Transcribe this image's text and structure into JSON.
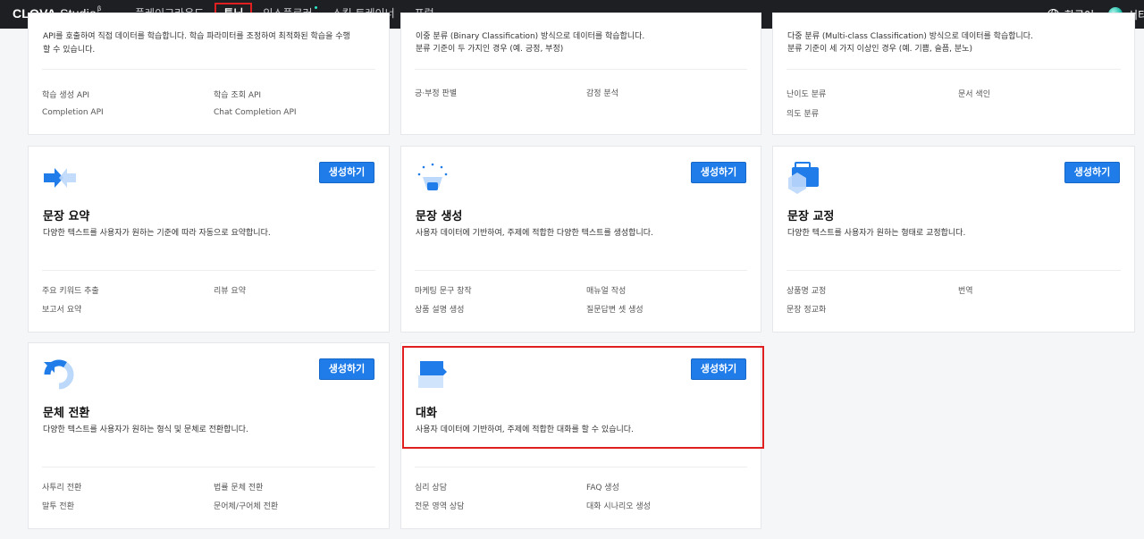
{
  "header": {
    "logo_brand": "CLOVA",
    "logo_product": "Studio",
    "logo_sup": "β",
    "nav": [
      {
        "label": "플레이그라운드"
      },
      {
        "label": "튜닝"
      },
      {
        "label": "익스플로러"
      },
      {
        "label": "스킬 트레이너"
      },
      {
        "label": "포럼"
      }
    ],
    "lang": "한국어",
    "user": "서티"
  },
  "top_cards": [
    {
      "desc_lines": [
        "API를 호출하여 직접 데이터를 학습합니다. 학습 파라미터를 조정하여 최적화된 학습을 수행",
        "할 수 있습니다."
      ],
      "tags": [
        "학습 생성 API",
        "학습 조회 API",
        "Completion API",
        "Chat Completion API"
      ]
    },
    {
      "desc_lines": [
        "이중 분류 (Binary Classification) 방식으로 데이터를 학습합니다.",
        "분류 기준이 두 가지인 경우 (예. 긍정, 부정)"
      ],
      "tags": [
        "긍·부정 판별",
        "감정 분석"
      ]
    },
    {
      "desc_lines": [
        "다중 분류 (Multi-class Classification) 방식으로 데이터를 학습합니다.",
        "분류 기준이 세 가지 이상인 경우 (예. 기쁨, 슬픔, 분노)"
      ],
      "tags": [
        "난이도 분류",
        "문서 색인",
        "의도 분류"
      ]
    }
  ],
  "cards": [
    {
      "title": "문장 요약",
      "desc": "다양한 텍스트를 사용자가 원하는 기준에 따라 자동으로 요약합니다.",
      "button": "생성하기",
      "icon": "arrows-summary-icon",
      "tags": [
        "주요 키워드 추출",
        "리뷰 요약",
        "보고서 요약"
      ]
    },
    {
      "title": "문장 생성",
      "desc": "사용자 데이터에 기반하여, 주제에 적합한 다양한 텍스트를 생성합니다.",
      "button": "생성하기",
      "icon": "lightbulb-icon",
      "tags": [
        "마케팅 문구 창작",
        "매뉴얼 작성",
        "상품 설명 생성",
        "질문답변 셋 생성"
      ]
    },
    {
      "title": "문장 교정",
      "desc": "다양한 텍스트를 사용자가 원하는 형태로 교정합니다.",
      "button": "생성하기",
      "icon": "toolbox-icon",
      "tags": [
        "상품명 교정",
        "번역",
        "문장 정교화"
      ]
    },
    {
      "title": "문체 전환",
      "desc": "다양한 텍스트를 사용자가 원하는 형식 및 문체로 전환합니다.",
      "button": "생성하기",
      "icon": "refresh-icon",
      "tags": [
        "사투리 전환",
        "법률 문체 전환",
        "말투 전환",
        "문어체/구어체 전환"
      ]
    },
    {
      "title": "대화",
      "desc": "사용자 데이터에 기반하여, 주제에 적합한 대화를 할 수 있습니다.",
      "button": "생성하기",
      "icon": "chat-bubble-icon",
      "tags": [
        "심리 상담",
        "FAQ 생성",
        "전문 영역 상담",
        "대화 시나리오 생성"
      ]
    }
  ],
  "colors": {
    "accent": "#1f7ce8",
    "highlight": "#e02020",
    "topbar": "#1e1f22"
  }
}
